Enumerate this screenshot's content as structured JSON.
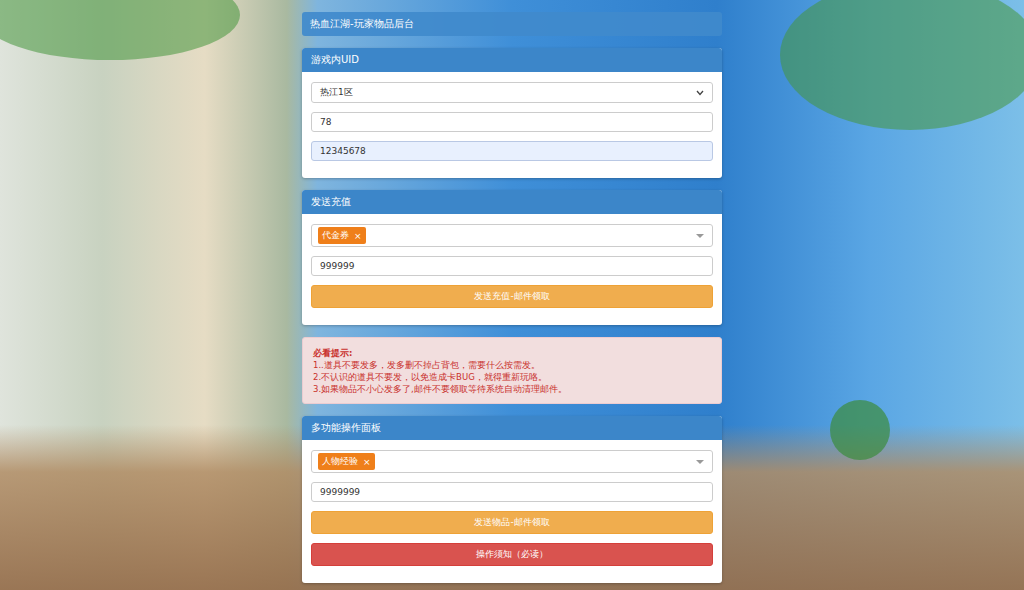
{
  "header": {
    "title": "热血江湖-玩家物品后台"
  },
  "uid_panel": {
    "title": "游戏内UID",
    "server": "热江1区",
    "fields": [
      {
        "value": "78",
        "highlighted": false
      },
      {
        "value": "12345678",
        "highlighted": true
      }
    ]
  },
  "recharge_panel": {
    "title": "发送充值",
    "tags": [
      {
        "label": "代金券",
        "remove": "×"
      }
    ],
    "amount": "999999",
    "button": "发送充值-邮件领取"
  },
  "notice": {
    "title": "必看提示:",
    "lines": [
      "1..道具不要发多，发多删不掉占背包，需要什么按需发。",
      "2.不认识的道具不要发，以免造成卡BUG，就得重新玩咯。",
      "3.如果物品不小心发多了,邮件不要领取等待系统自动清理邮件。"
    ]
  },
  "multi_panel": {
    "title": "多功能操作面板",
    "tags": [
      {
        "label": "人物经验",
        "remove": "×"
      }
    ],
    "amount": "9999999",
    "buttons": [
      {
        "label": "发送物品-邮件领取",
        "kind": "primary"
      },
      {
        "label": "操作须知（必读）",
        "kind": "danger"
      }
    ]
  }
}
